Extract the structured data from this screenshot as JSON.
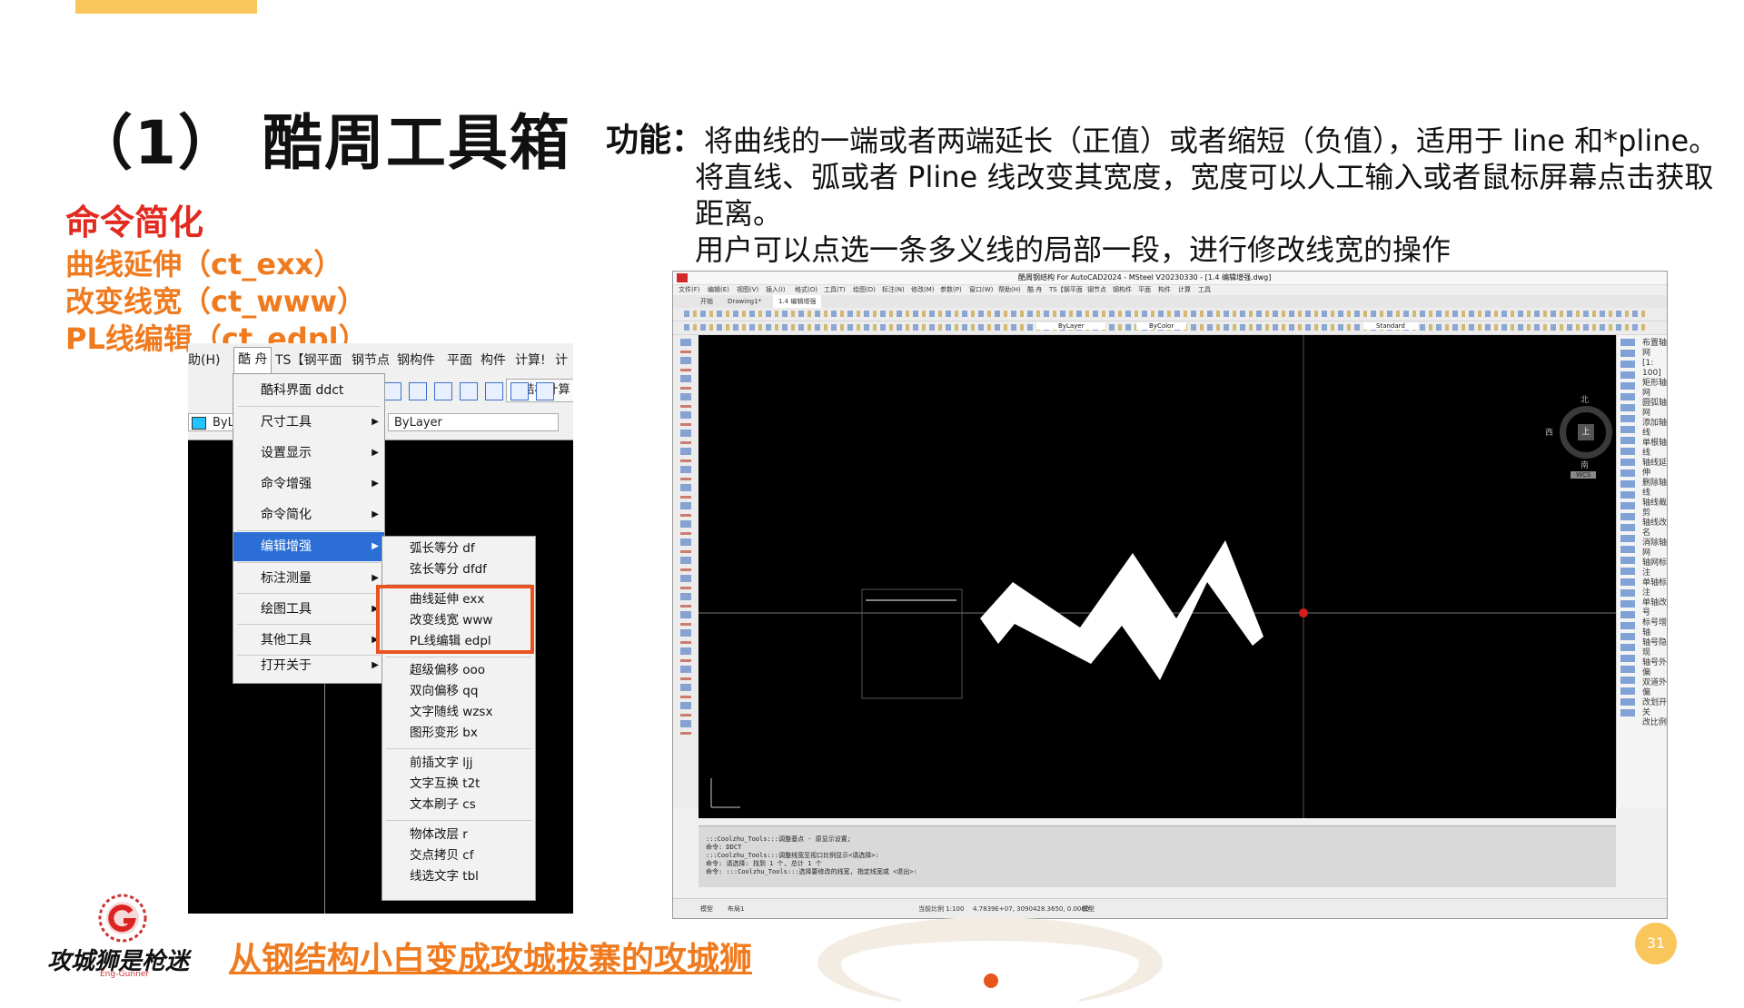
{
  "slide": {
    "title": "（1） 酷周工具箱",
    "section_heading": "命令简化",
    "items": [
      "曲线延伸（ct_exx）",
      "改变线宽（ct_www）",
      "PL线编辑（ct_edpl）"
    ],
    "function_label": "功能：",
    "function_lines": [
      "将曲线的一端或者两端延长（正值）或者缩短（负值），适用于 line 和*pline。",
      "将直线、弧或者 Pline 线改变其宽度，宽度可以人工输入或者鼠标屏幕点击获取距离。",
      "用户可以点选一条多义线的局部一段，进行修改线宽的操作"
    ],
    "footer_text": "从钢结构小白变成攻城拔寨的攻城狮",
    "logo_text": "攻城狮是枪迷",
    "logo_sub": "Eng-Gunner",
    "page_number": "31",
    "accent_color": "#F07A1E",
    "heading_color": "#E22B20"
  },
  "left_screenshot": {
    "menubar": [
      "助(H)",
      "酷 舟",
      "TS【钢平面",
      "钢节点",
      "钢构件",
      "平面",
      "构件",
      "计算!",
      "计"
    ],
    "active_menu": "酷 舟",
    "button_label": "钢结构计算",
    "layer_value": "ByLayer",
    "bylayer_short": "ByL",
    "main_menu": [
      {
        "label": "酷科界面 ddct",
        "arrow": false
      },
      {
        "label": "尺寸工具",
        "arrow": true
      },
      {
        "label": "设置显示",
        "arrow": true
      },
      {
        "label": "命令增强",
        "arrow": true
      },
      {
        "label": "命令简化",
        "arrow": true
      },
      {
        "label": "编辑增强",
        "arrow": true,
        "selected": true
      },
      {
        "label": "标注测量",
        "arrow": true
      },
      {
        "label": "绘图工具",
        "arrow": true
      },
      {
        "label": "其他工具",
        "arrow": true
      },
      {
        "label": "打开关于",
        "arrow": true
      }
    ],
    "submenu_groups": [
      [
        "弧长等分 df",
        "弦长等分 dfdf"
      ],
      [
        "曲线延伸 exx",
        "改变线宽 www",
        "PL线编辑 edpl"
      ],
      [
        "超级偏移 ooo",
        "双向偏移 qq",
        "文字随线 wzsx",
        "图形变形 bx"
      ],
      [
        "前插文字 ljj",
        "文字互换 t2t",
        "文本刷子 cs"
      ],
      [
        "物体改层 r",
        "交点拷贝 cf",
        "线选文字 tbl"
      ]
    ],
    "arrow_glyph": "▶"
  },
  "right_screenshot": {
    "window_title": "酷周钢结构 For AutoCAD2024 - MSteel V20230330 - [1.4 编辑增强.dwg]",
    "menu_items": [
      "文件(F)",
      "编辑(E)",
      "视图(V)",
      "插入(I)",
      "格式(O)",
      "工具(T)",
      "绘图(D)",
      "标注(N)",
      "修改(M)",
      "参数(P)",
      "窗口(W)",
      "帮助(H)",
      "酷 舟",
      "TS【钢平面",
      "钢节点",
      "钢构件",
      "平面",
      "构件",
      "计算",
      "工具"
    ],
    "tabs": [
      "开始",
      "Drawing1*",
      "1.4 编辑增强"
    ],
    "layer": "ByLayer",
    "color": "ByColor",
    "style": "Standard",
    "right_panel": [
      "布置轴网",
      "[1: 100]",
      "矩形轴网",
      "圆弧轴网",
      "添加轴线",
      "单根轴线",
      "轴线延伸",
      "删除轴线",
      "轴线裁剪",
      "轴线改名",
      "消除轴网",
      "轴网标注",
      "单轴标注",
      "单轴改号",
      "标号增轴",
      "轴号隐现",
      "轴号外偏",
      "双道外偏",
      "改划开关",
      "改比例"
    ],
    "compass": {
      "n": "北",
      "s": "南",
      "w": "西",
      "e": "东",
      "center": "上"
    },
    "wcs": "WCS",
    "command_lines": [
      ":::Coolzhu_Tools:::调整基点 - 原显示设置;",
      "命令: DDCT",
      ":::Coolzhu_Tools:::调整线宽至视口比例显示<请选择>:",
      "命令: 请选择: 找到 1 个, 总计 1 个",
      "命令: :::Coolzhu_Tools:::选择要修改的线宽, 指定线宽或 <退出>:"
    ],
    "status": [
      "模型",
      "布局1",
      "当前比例 1:100",
      "4.7839E+07, 3090428.3650, 0.0000",
      "模型"
    ],
    "red_point_color": "#d61e1e"
  }
}
